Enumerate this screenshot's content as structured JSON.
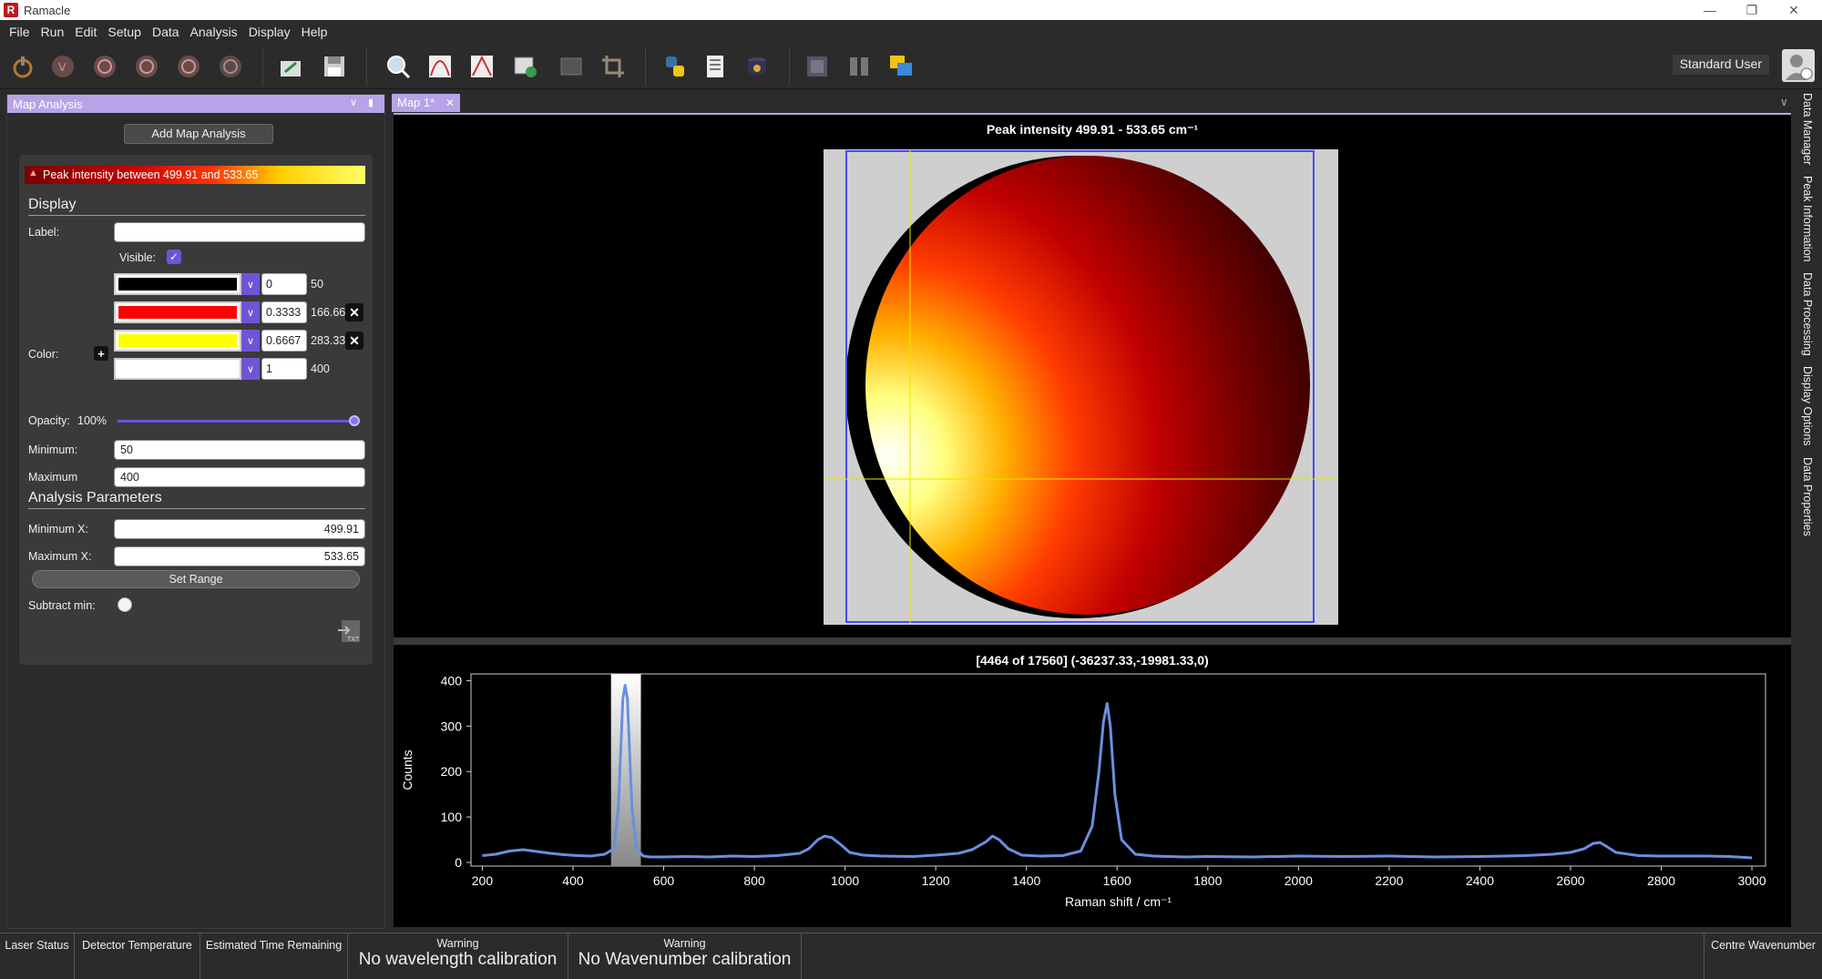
{
  "app": {
    "title": "Ramacle"
  },
  "menu": [
    "File",
    "Run",
    "Edit",
    "Setup",
    "Data",
    "Analysis",
    "Display",
    "Help"
  ],
  "user": {
    "name": "Standard User"
  },
  "left_panel": {
    "title": "Map Analysis",
    "add_button": "Add Map Analysis",
    "analysis_item": "Peak intensity between 499.91 and 533.65",
    "display_section": "Display",
    "label_label": "Label:",
    "label_value": "",
    "visible_label": "Visible:",
    "visible_checked": true,
    "color_label": "Color:",
    "color_stops": [
      {
        "color": "#000000",
        "position": "0",
        "value": "50",
        "removable": false
      },
      {
        "color": "#ff0000",
        "position": "0.3333",
        "value": "166.66",
        "removable": true
      },
      {
        "color": "#ffff00",
        "position": "0.6667",
        "value": "283.33",
        "removable": true
      },
      {
        "color": "#ffffff",
        "position": "1",
        "value": "400",
        "removable": false
      }
    ],
    "opacity_label": "Opacity:",
    "opacity_value": "100%",
    "opacity_level": 1.0,
    "minimum_label": "Minimum:",
    "minimum_value": "50",
    "maximum_label": "Maximum",
    "maximum_value": "400",
    "analysis_section": "Analysis Parameters",
    "min_x_label": "Minimum X:",
    "min_x_value": "499.91",
    "max_x_label": "Maximum X:",
    "max_x_value": "533.65",
    "set_range_button": "Set Range",
    "subtract_min_label": "Subtract min:",
    "subtract_min_checked": false
  },
  "tabs": [
    {
      "label": "Map 1*",
      "active": true
    }
  ],
  "map": {
    "title": "Peak intensity  499.91 - 533.65 cm⁻¹"
  },
  "spectrum": {
    "title": "[4464 of 17560] (-36237.33,-19981.33,0)"
  },
  "chart_data": {
    "type": "line",
    "xlabel": "Raman shift / cm⁻¹",
    "ylabel": "Counts",
    "xlim": [
      175,
      3030
    ],
    "ylim": [
      -8,
      415
    ],
    "xticks": [
      200,
      400,
      600,
      800,
      1000,
      1200,
      1400,
      1600,
      1800,
      2000,
      2200,
      2400,
      2600,
      2800,
      3000
    ],
    "yticks": [
      0,
      100,
      200,
      300,
      400
    ],
    "highlight_range": [
      499.91,
      533.65
    ],
    "series": [
      {
        "color": "#6a8fe0",
        "x": [
          200,
          230,
          260,
          290,
          320,
          350,
          380,
          410,
          440,
          470,
          490,
          500,
          510,
          515,
          520,
          530,
          540,
          555,
          570,
          600,
          650,
          700,
          750,
          800,
          850,
          900,
          920,
          940,
          955,
          970,
          990,
          1010,
          1040,
          1080,
          1150,
          1200,
          1250,
          1280,
          1310,
          1325,
          1340,
          1360,
          1390,
          1430,
          1480,
          1520,
          1545,
          1560,
          1570,
          1578,
          1585,
          1595,
          1610,
          1640,
          1680,
          1750,
          1800,
          1900,
          2000,
          2100,
          2200,
          2300,
          2400,
          2500,
          2560,
          2600,
          2630,
          2650,
          2665,
          2680,
          2700,
          2750,
          2800,
          2900,
          2950,
          3000
        ],
        "y": [
          15,
          18,
          25,
          28,
          24,
          20,
          17,
          15,
          14,
          18,
          30,
          120,
          360,
          390,
          360,
          120,
          30,
          14,
          12,
          12,
          13,
          12,
          14,
          13,
          15,
          20,
          30,
          50,
          58,
          55,
          40,
          22,
          16,
          14,
          13,
          16,
          20,
          28,
          45,
          58,
          50,
          30,
          16,
          14,
          15,
          25,
          80,
          200,
          310,
          350,
          300,
          150,
          50,
          18,
          14,
          12,
          13,
          12,
          14,
          13,
          14,
          12,
          13,
          15,
          18,
          22,
          30,
          42,
          44,
          35,
          22,
          15,
          14,
          14,
          13,
          10
        ]
      }
    ]
  },
  "side_tabs": [
    "Data Manager",
    "Peak Information",
    "Data Processing",
    "Display Options",
    "Data Properties"
  ],
  "status": {
    "laser": "Laser Status",
    "detector": "Detector Temperature",
    "time": "Estimated Time Remaining",
    "warn1_title": "Warning",
    "warn1_text": "No wavelength calibration",
    "warn2_title": "Warning",
    "warn2_text": "No Wavenumber calibration",
    "centre": "Centre Wavenumber"
  }
}
